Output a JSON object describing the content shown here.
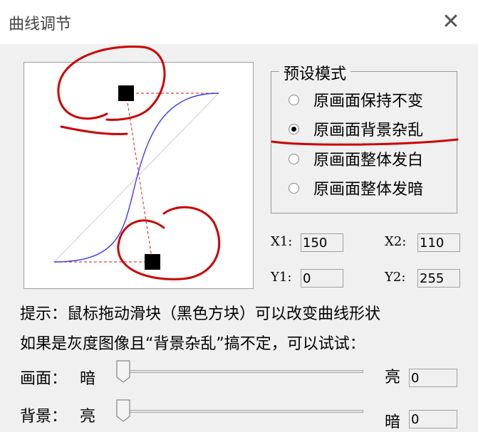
{
  "window": {
    "title": "曲线调节"
  },
  "preset": {
    "legend": "预设模式",
    "options": [
      "原画面保持不变",
      "原画面背景杂乱",
      "原画面整体发白",
      "原画面整体发暗"
    ],
    "selected_index": 1
  },
  "coords": {
    "x1": {
      "label": "X1:",
      "value": "150"
    },
    "x2": {
      "label": "X2:",
      "value": "110"
    },
    "y1": {
      "label": "Y1:",
      "value": "0"
    },
    "y2": {
      "label": "Y2:",
      "value": "255"
    }
  },
  "hints": {
    "line1": "提示：鼠标拖动滑块（黑色方块）可以改变曲线形状",
    "line2": "如果是灰度图像且“背景杂乱”搞不定，可以试试："
  },
  "picture": {
    "label": "画面：",
    "low": "暗",
    "high": "亮",
    "value": "0",
    "level": 0
  },
  "background": {
    "label": "背景：",
    "low": "亮",
    "high": "暗",
    "value": "0",
    "level": 0
  },
  "colors": {
    "curve": "#3a3aff",
    "guide": "#e04040",
    "annotation": "#cc0000"
  }
}
